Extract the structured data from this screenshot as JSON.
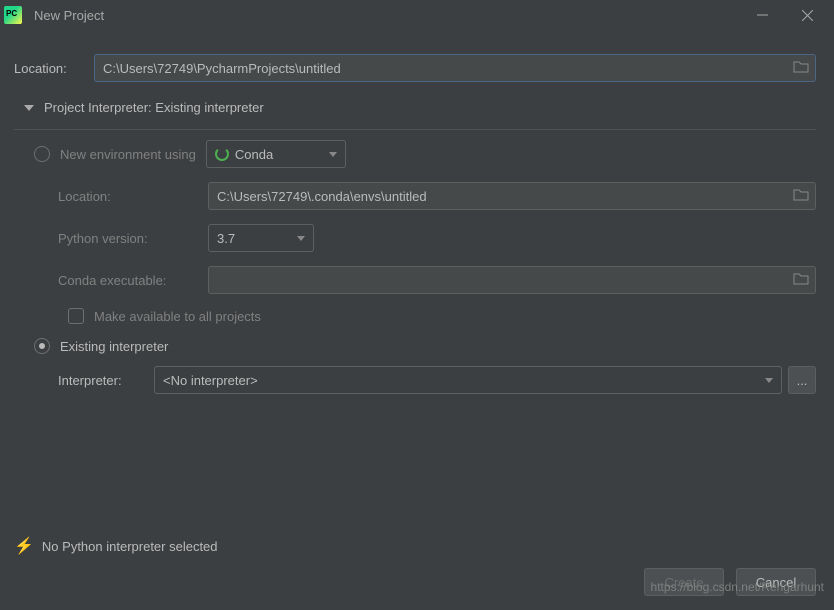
{
  "window": {
    "title": "New Project"
  },
  "location": {
    "label": "Location:",
    "value": "C:\\Users\\72749\\PycharmProjects\\untitled"
  },
  "section": {
    "header": "Project Interpreter: Existing interpreter"
  },
  "newEnv": {
    "label": "New environment using",
    "tool": "Conda",
    "locationLabel": "Location:",
    "locationValue": "C:\\Users\\72749\\.conda\\envs\\untitled",
    "pyVersionLabel": "Python version:",
    "pyVersionValue": "3.7",
    "condaExecLabel": "Conda executable:",
    "condaExecValue": "",
    "makeAvailable": "Make available to all projects"
  },
  "existing": {
    "label": "Existing interpreter",
    "interpLabel": "Interpreter:",
    "interpValue": "<No interpreter>",
    "ellipsis": "..."
  },
  "warning": "No Python interpreter selected",
  "buttons": {
    "create": "Create",
    "cancel": "Cancel"
  },
  "watermark": "https://blog.csdn.net/Rengarhunt"
}
